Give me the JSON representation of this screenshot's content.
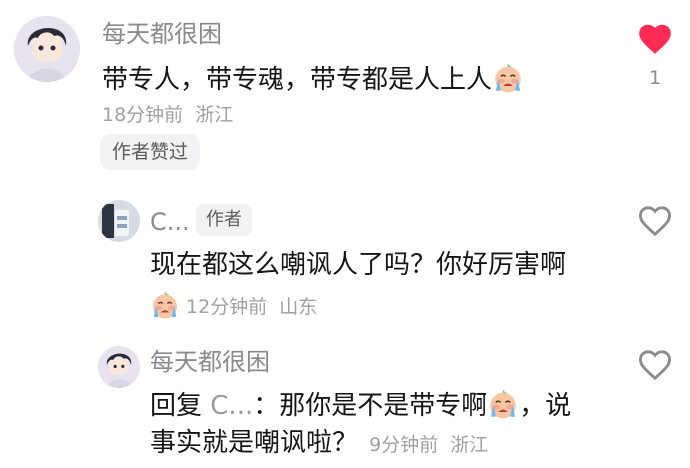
{
  "comments": [
    {
      "username": "每天都很困",
      "text_before_emoji": "带专人，带专魂，带专都是人上人",
      "emoji": "crying-face-emoji",
      "time": "18分钟前",
      "location": "浙江",
      "badge": "作者赞过",
      "likes": "1",
      "liked": true
    },
    {
      "username": "C...",
      "author_tag": "作者",
      "text": "现在都这么嘲讽人了吗？你好厉害啊",
      "emoji": "crying-face-emoji",
      "time": "12分钟前",
      "location": "山东",
      "liked": false
    },
    {
      "username": "每天都很困",
      "reply_prefix": "回复",
      "reply_to": "C...",
      "text_line1_before_emoji": "：那你是不是带专啊",
      "text_line1_after_emoji": "，说",
      "text_line2": "事实就是嘲讽啦？",
      "emoji": "crying-face-emoji",
      "time": "9分钟前",
      "location": "浙江",
      "liked": false
    }
  ],
  "colors": {
    "like_active": "#fe2c55",
    "like_inactive": "#8a8a8f",
    "username": "#8a8a8f",
    "text": "#161616",
    "meta": "#a0a0a4"
  }
}
